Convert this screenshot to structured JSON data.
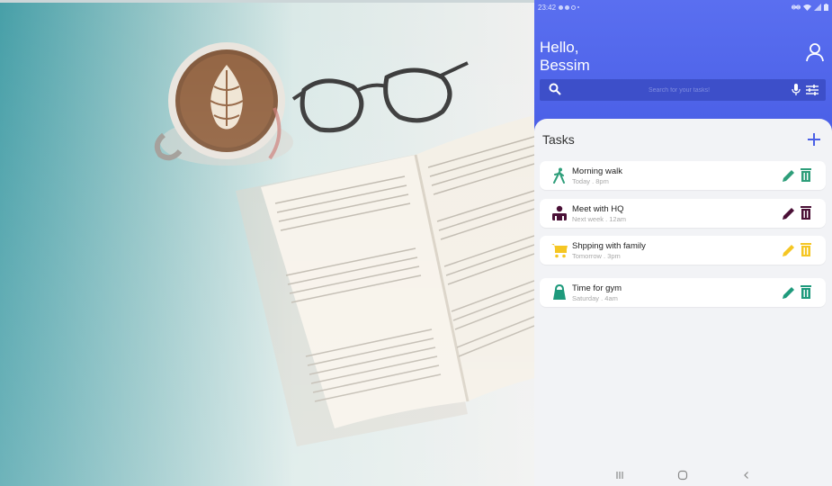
{
  "status_bar": {
    "time": "23:42"
  },
  "header": {
    "greeting_line1": "Hello,",
    "greeting_line2": "Bessim"
  },
  "search": {
    "placeholder": "Search for your tasks!"
  },
  "tasks": {
    "title": "Tasks",
    "items": [
      {
        "name": "Morning walk",
        "when": "Today . 8pm",
        "icon": "walking-person-icon",
        "color": "#2e9e7a"
      },
      {
        "name": "Meet with HQ",
        "when": "Next week . 12am",
        "icon": "meeting-icon",
        "color": "#4a1036"
      },
      {
        "name": "Shpping with family",
        "when": "Tomorrow . 3pm",
        "icon": "shopping-cart-icon",
        "color": "#f5c623"
      },
      {
        "name": "Time for gym",
        "when": "Saturday . 4am",
        "icon": "gym-weight-icon",
        "color": "#1e9a7c"
      }
    ]
  },
  "colors": {
    "header": "#5067ee",
    "search_bar": "#3d4fc9",
    "walk": "#2e9e7a",
    "meeting": "#4a1036",
    "shopping": "#f5c623",
    "gym": "#1e9a7c",
    "add": "#4a5fe6"
  }
}
